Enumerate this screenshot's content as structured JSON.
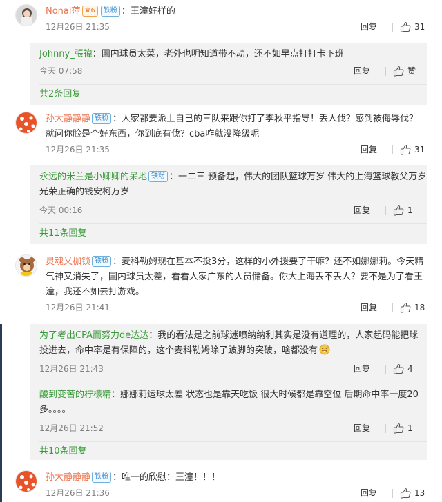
{
  "comments": [
    {
      "user": "Nonal萍",
      "badge": "铁粉",
      "text": "：王潼好样的",
      "time": "12月26日 21:35",
      "reply": "回复",
      "likes": "31",
      "sub": [
        {
          "user": "Johnny_張禕",
          "text": "：国内球员太菜，老外也明知道带不动，还不如早点打打卡下班",
          "time": "今天 07:58",
          "reply": "回复",
          "likes": "赞"
        }
      ],
      "more": "共2条回复"
    },
    {
      "user": "孙大静静静",
      "badge": "铁粉",
      "text": "：人家都要派上自己的三队来跟你打了李秋平指导！丢人伐？感到被侮辱伐？就问你脸是个好东西，你到底有伐？cba咋就没降级呢",
      "time": "12月26日 21:35",
      "reply": "回复",
      "likes": "31",
      "sub": [
        {
          "user": "永远的米兰是小卿卿的呆地",
          "badge": "铁粉",
          "text": "：一二三 预备起，伟大的团队篮球万岁 伟大的上海篮球教父万岁 光荣正确的钱安柯万岁",
          "time": "今天 00:16",
          "reply": "回复",
          "likes": "1"
        }
      ],
      "more": "共11条回复"
    },
    {
      "user": "灵魂乂枷锁",
      "badge": "铁粉",
      "text": "：麦科勒姆现在基本不投3分，这样的小外援要了干嘛？还不如娜娜莉。今天精气神又消失了，国内球员太差，看看人家广东的人员储备。你大上海丢不丢人？要不是为了看王潼，我还不如去打游戏。",
      "time": "12月26日 21:41",
      "reply": "回复",
      "likes": "18",
      "sub": [
        {
          "user": "为了考出CPA而努力de达达",
          "text": "：我的看法是之前球迷喷纳纳利其实是没有道理的，人家起码能把球投进去，命中率是有保障的，这个麦科勒姆除了跛脚的突破，啥都没有",
          "emoji": "grin-sweat-emoji",
          "time": "12月26日 21:43",
          "reply": "回复",
          "likes": "4"
        },
        {
          "user": "酸到变苦的柠檬精",
          "text": "：娜娜莉运球太差  状态也是靠天吃饭  很大时候都是靠空位  后期命中率一度20多。。。。",
          "time": "12月26日 21:52",
          "reply": "回复",
          "likes": "1"
        }
      ],
      "more": "共10条回复"
    },
    {
      "user": "孙大静静静",
      "badge": "铁粉",
      "text": "：唯一的欣慰：王潼！！！",
      "time": "12月26日 21:36",
      "reply": "回复",
      "likes": "13"
    }
  ],
  "vip_badge": "6",
  "colors": {
    "username": "#eb7350",
    "sub_username": "#3a9a3a",
    "badge": "#3f8fd0"
  }
}
